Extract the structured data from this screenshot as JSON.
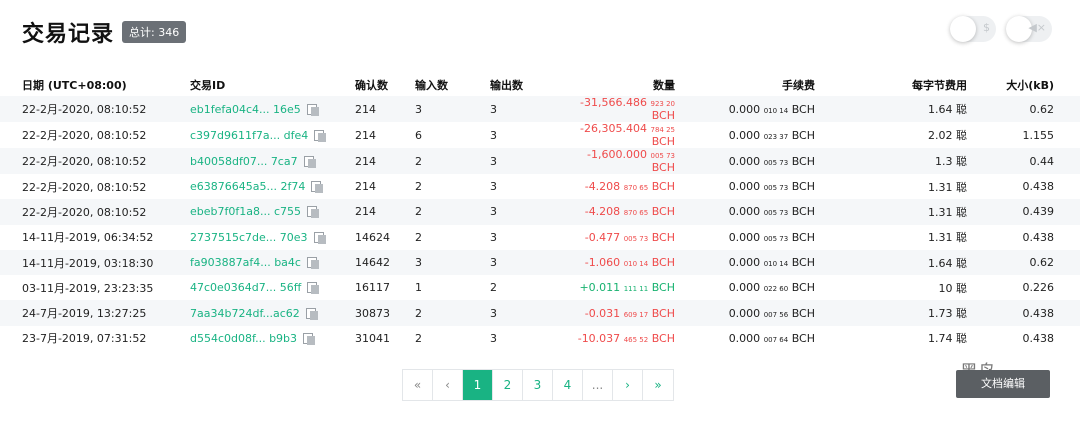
{
  "header": {
    "title": "交易记录",
    "total": "总计: 346"
  },
  "toggles": [
    {
      "icon": "dollar-icon",
      "glyph": "$"
    },
    {
      "icon": "mute-icon",
      "glyph": "◀×"
    }
  ],
  "table": {
    "columns": [
      "日期 (UTC+08:00)",
      "交易ID",
      "确认数",
      "输入数",
      "输出数",
      "数量",
      "手续费",
      "每字节费用",
      "大小(kB)"
    ],
    "rows": [
      {
        "date": "22-2月-2020, 08:10:52",
        "txid": "eb1fefa04c4... 16e5",
        "conf": "214",
        "in": "3",
        "out": "3",
        "amt": "-31,566.486",
        "amt_small": "923 20",
        "amt_unit": "BCH",
        "sign": "neg",
        "fee": "0.000",
        "fee_small": "010 14",
        "fee_unit": "BCH",
        "rate": "1.64 聪",
        "size": "0.62"
      },
      {
        "date": "22-2月-2020, 08:10:52",
        "txid": "c397d9611f7a... dfe4",
        "conf": "214",
        "in": "6",
        "out": "3",
        "amt": "-26,305.404",
        "amt_small": "784 25",
        "amt_unit": "BCH",
        "sign": "neg",
        "fee": "0.000",
        "fee_small": "023 37",
        "fee_unit": "BCH",
        "rate": "2.02 聪",
        "size": "1.155"
      },
      {
        "date": "22-2月-2020, 08:10:52",
        "txid": "b40058df07... 7ca7",
        "conf": "214",
        "in": "2",
        "out": "3",
        "amt": "-1,600.000",
        "amt_small": "005 73",
        "amt_unit": "BCH",
        "sign": "neg",
        "fee": "0.000",
        "fee_small": "005 73",
        "fee_unit": "BCH",
        "rate": "1.3 聪",
        "size": "0.44"
      },
      {
        "date": "22-2月-2020, 08:10:52",
        "txid": "e63876645a5... 2f74",
        "conf": "214",
        "in": "2",
        "out": "3",
        "amt": "-4.208",
        "amt_small": "870 65",
        "amt_unit": "BCH",
        "sign": "neg",
        "fee": "0.000",
        "fee_small": "005 73",
        "fee_unit": "BCH",
        "rate": "1.31 聪",
        "size": "0.438"
      },
      {
        "date": "22-2月-2020, 08:10:52",
        "txid": "ebeb7f0f1a8... c755",
        "conf": "214",
        "in": "2",
        "out": "3",
        "amt": "-4.208",
        "amt_small": "870 65",
        "amt_unit": "BCH",
        "sign": "neg",
        "fee": "0.000",
        "fee_small": "005 73",
        "fee_unit": "BCH",
        "rate": "1.31 聪",
        "size": "0.439"
      },
      {
        "date": "14-11月-2019, 06:34:52",
        "txid": "2737515c7de... 70e3",
        "conf": "14624",
        "in": "2",
        "out": "3",
        "amt": "-0.477",
        "amt_small": "005 73",
        "amt_unit": "BCH",
        "sign": "neg",
        "fee": "0.000",
        "fee_small": "005 73",
        "fee_unit": "BCH",
        "rate": "1.31 聪",
        "size": "0.438"
      },
      {
        "date": "14-11月-2019, 03:18:30",
        "txid": "fa903887af4... ba4c",
        "conf": "14642",
        "in": "3",
        "out": "3",
        "amt": "-1.060",
        "amt_small": "010 14",
        "amt_unit": "BCH",
        "sign": "neg",
        "fee": "0.000",
        "fee_small": "010 14",
        "fee_unit": "BCH",
        "rate": "1.64 聪",
        "size": "0.62"
      },
      {
        "date": "03-11月-2019, 23:23:35",
        "txid": "47c0e0364d7... 56ff",
        "conf": "16117",
        "in": "1",
        "out": "2",
        "amt": "+0.011",
        "amt_small": "111 11",
        "amt_unit": "BCH",
        "sign": "pos",
        "fee": "0.000",
        "fee_small": "022 60",
        "fee_unit": "BCH",
        "rate": "10 聪",
        "size": "0.226"
      },
      {
        "date": "24-7月-2019, 13:27:25",
        "txid": "7aa34b724df...ac62",
        "conf": "30873",
        "in": "2",
        "out": "3",
        "amt": "-0.031",
        "amt_small": "609 17",
        "amt_unit": "BCH",
        "sign": "neg",
        "fee": "0.000",
        "fee_small": "007 56",
        "fee_unit": "BCH",
        "rate": "1.73 聪",
        "size": "0.438"
      },
      {
        "date": "23-7月-2019, 07:31:52",
        "txid": "d554c0d08f... b9b3",
        "conf": "31041",
        "in": "2",
        "out": "3",
        "amt": "-10.037",
        "amt_small": "465 52",
        "amt_unit": "BCH",
        "sign": "neg",
        "fee": "0.000",
        "fee_small": "007 64",
        "fee_unit": "BCH",
        "rate": "1.74 聪",
        "size": "0.438"
      }
    ]
  },
  "pagination": {
    "items": [
      {
        "label": "«",
        "name": "first-page-button",
        "kind": "muted"
      },
      {
        "label": "‹",
        "name": "prev-page-button",
        "kind": "muted"
      },
      {
        "label": "1",
        "name": "page-1-button",
        "kind": "active"
      },
      {
        "label": "2",
        "name": "page-2-button",
        "kind": ""
      },
      {
        "label": "3",
        "name": "page-3-button",
        "kind": ""
      },
      {
        "label": "4",
        "name": "page-4-button",
        "kind": ""
      },
      {
        "label": "...",
        "name": "page-ellipsis",
        "kind": "muted"
      },
      {
        "label": "›",
        "name": "next-page-button",
        "kind": ""
      },
      {
        "label": "»",
        "name": "last-page-button",
        "kind": ""
      }
    ]
  },
  "watermark": {
    "top": "黑鸟",
    "bottom": "文档编辑"
  }
}
